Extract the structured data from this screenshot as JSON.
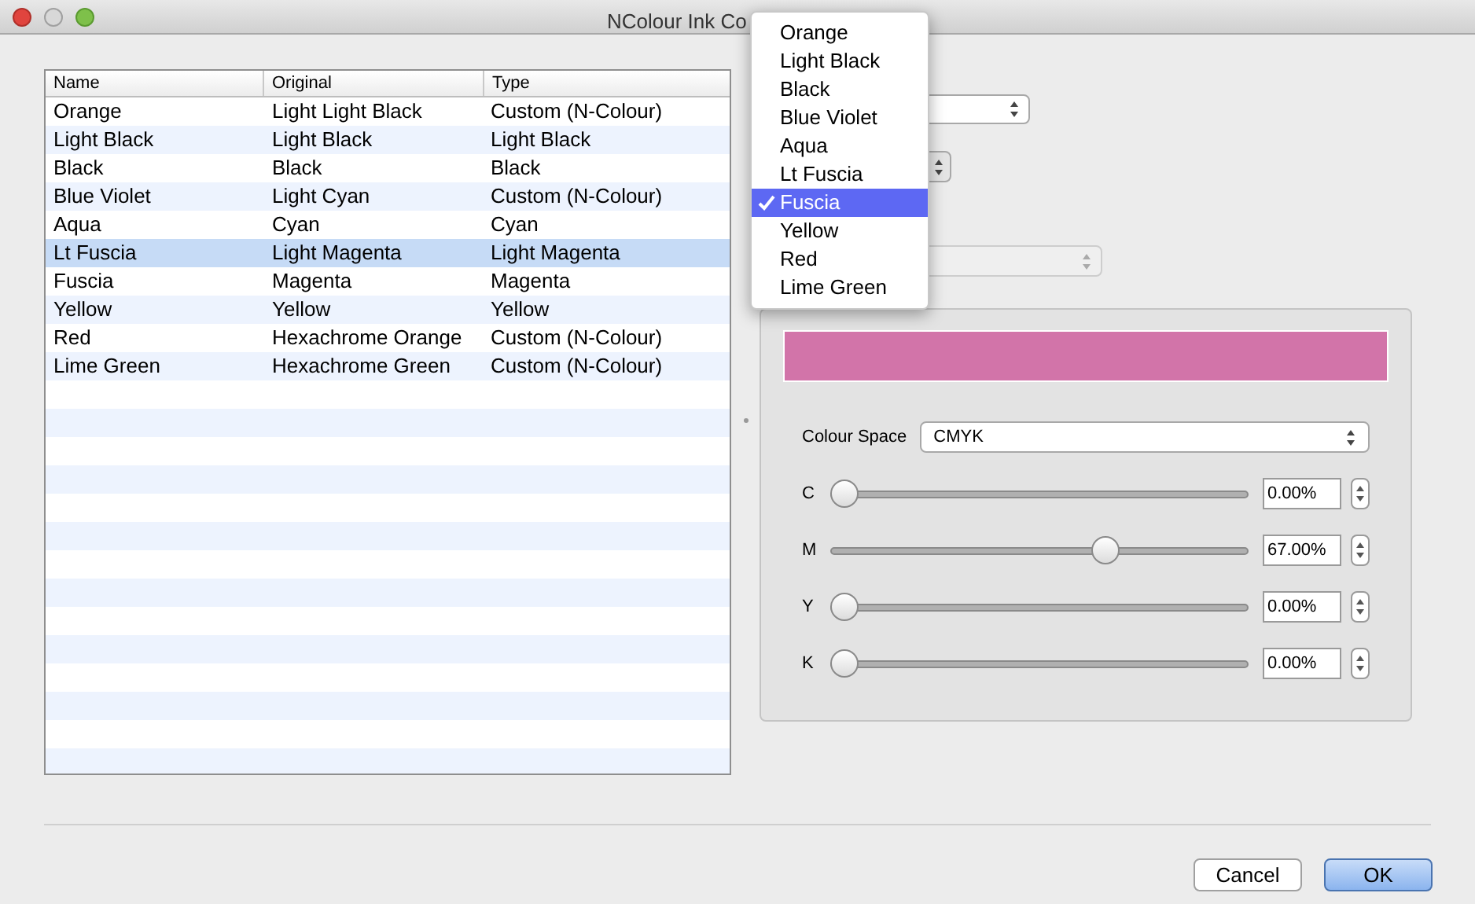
{
  "window": {
    "title": "NColour Ink Co"
  },
  "table": {
    "columns": [
      "Name",
      "Original",
      "Type"
    ],
    "rows": [
      {
        "cells": [
          "Orange",
          "Light Light Black",
          "Custom (N-Colour)"
        ],
        "selected": false
      },
      {
        "cells": [
          "Light Black",
          "Light Black",
          "Light Black"
        ],
        "selected": false
      },
      {
        "cells": [
          "Black",
          "Black",
          "Black"
        ],
        "selected": false
      },
      {
        "cells": [
          "Blue Violet",
          "Light Cyan",
          "Custom (N-Colour)"
        ],
        "selected": false
      },
      {
        "cells": [
          "Aqua",
          "Cyan",
          "Cyan"
        ],
        "selected": false
      },
      {
        "cells": [
          "Lt Fuscia",
          "Light Magenta",
          "Light Magenta"
        ],
        "selected": true
      },
      {
        "cells": [
          "Fuscia",
          "Magenta",
          "Magenta"
        ],
        "selected": false
      },
      {
        "cells": [
          "Yellow",
          "Yellow",
          "Yellow"
        ],
        "selected": false
      },
      {
        "cells": [
          "Red",
          "Hexachrome Orange",
          "Custom (N-Colour)"
        ],
        "selected": false
      },
      {
        "cells": [
          "Lime Green",
          "Hexachrome Green",
          "Custom (N-Colour)"
        ],
        "selected": false
      }
    ]
  },
  "menu": {
    "items": [
      {
        "label": "Orange",
        "selected": false
      },
      {
        "label": "Light Black",
        "selected": false
      },
      {
        "label": "Black",
        "selected": false
      },
      {
        "label": "Blue Violet",
        "selected": false
      },
      {
        "label": "Aqua",
        "selected": false
      },
      {
        "label": "Lt Fuscia",
        "selected": false
      },
      {
        "label": "Fuscia",
        "selected": true
      },
      {
        "label": "Yellow",
        "selected": false
      },
      {
        "label": "Red",
        "selected": false
      },
      {
        "label": "Lime Green",
        "selected": false
      }
    ]
  },
  "colour_panel": {
    "swatch": {
      "color": "#d274a9"
    },
    "colour_space_label": "Colour Space",
    "colour_space": "CMYK",
    "channels": [
      {
        "label": "C",
        "level": 0,
        "reading": "0.00%"
      },
      {
        "label": "M",
        "level": 0.67,
        "reading": "67.00%"
      },
      {
        "label": "Y",
        "level": 0,
        "reading": "0.00%"
      },
      {
        "label": "K",
        "level": 0,
        "reading": "0.00%"
      }
    ]
  },
  "buttons": [
    {
      "label": "Cancel",
      "kind": "normal"
    },
    {
      "label": "OK",
      "kind": "default"
    }
  ]
}
